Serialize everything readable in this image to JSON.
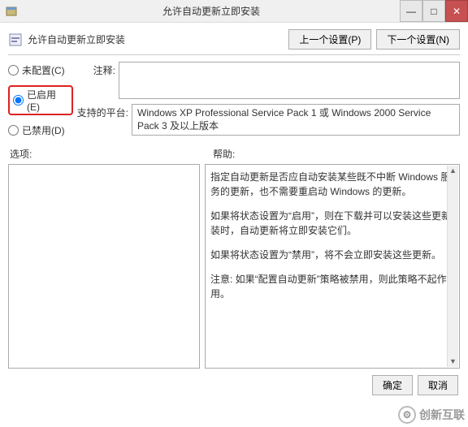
{
  "window": {
    "title": "允许自动更新立即安装"
  },
  "header": {
    "label": "允许自动更新立即安装",
    "prev_btn": "上一个设置(P)",
    "next_btn": "下一个设置(N)"
  },
  "radios": {
    "not_configured": "未配置(C)",
    "enabled": "已启用(E)",
    "disabled": "已禁用(D)",
    "selected": "enabled"
  },
  "fields": {
    "comment_label": "注释:",
    "comment_value": "",
    "platform_label": "支持的平台:",
    "platform_value": "Windows XP Professional Service Pack 1 或 Windows 2000 Service Pack 3 及以上版本"
  },
  "mid": {
    "options_label": "选项:",
    "help_label": "帮助:"
  },
  "help": {
    "p1": "指定自动更新是否应自动安装某些既不中断 Windows 服务的更新，也不需要重启动 Windows 的更新。",
    "p2": "如果将状态设置为“启用”，则在下载并可以安装这些更新装时，自动更新将立即安装它们。",
    "p3": "如果将状态设置为“禁用”，将不会立即安装这些更新。",
    "p4": "注意: 如果“配置自动更新”策略被禁用，则此策略不起作用。"
  },
  "buttons": {
    "ok": "确定",
    "cancel": "取消"
  },
  "watermark": {
    "text": "创新互联"
  }
}
